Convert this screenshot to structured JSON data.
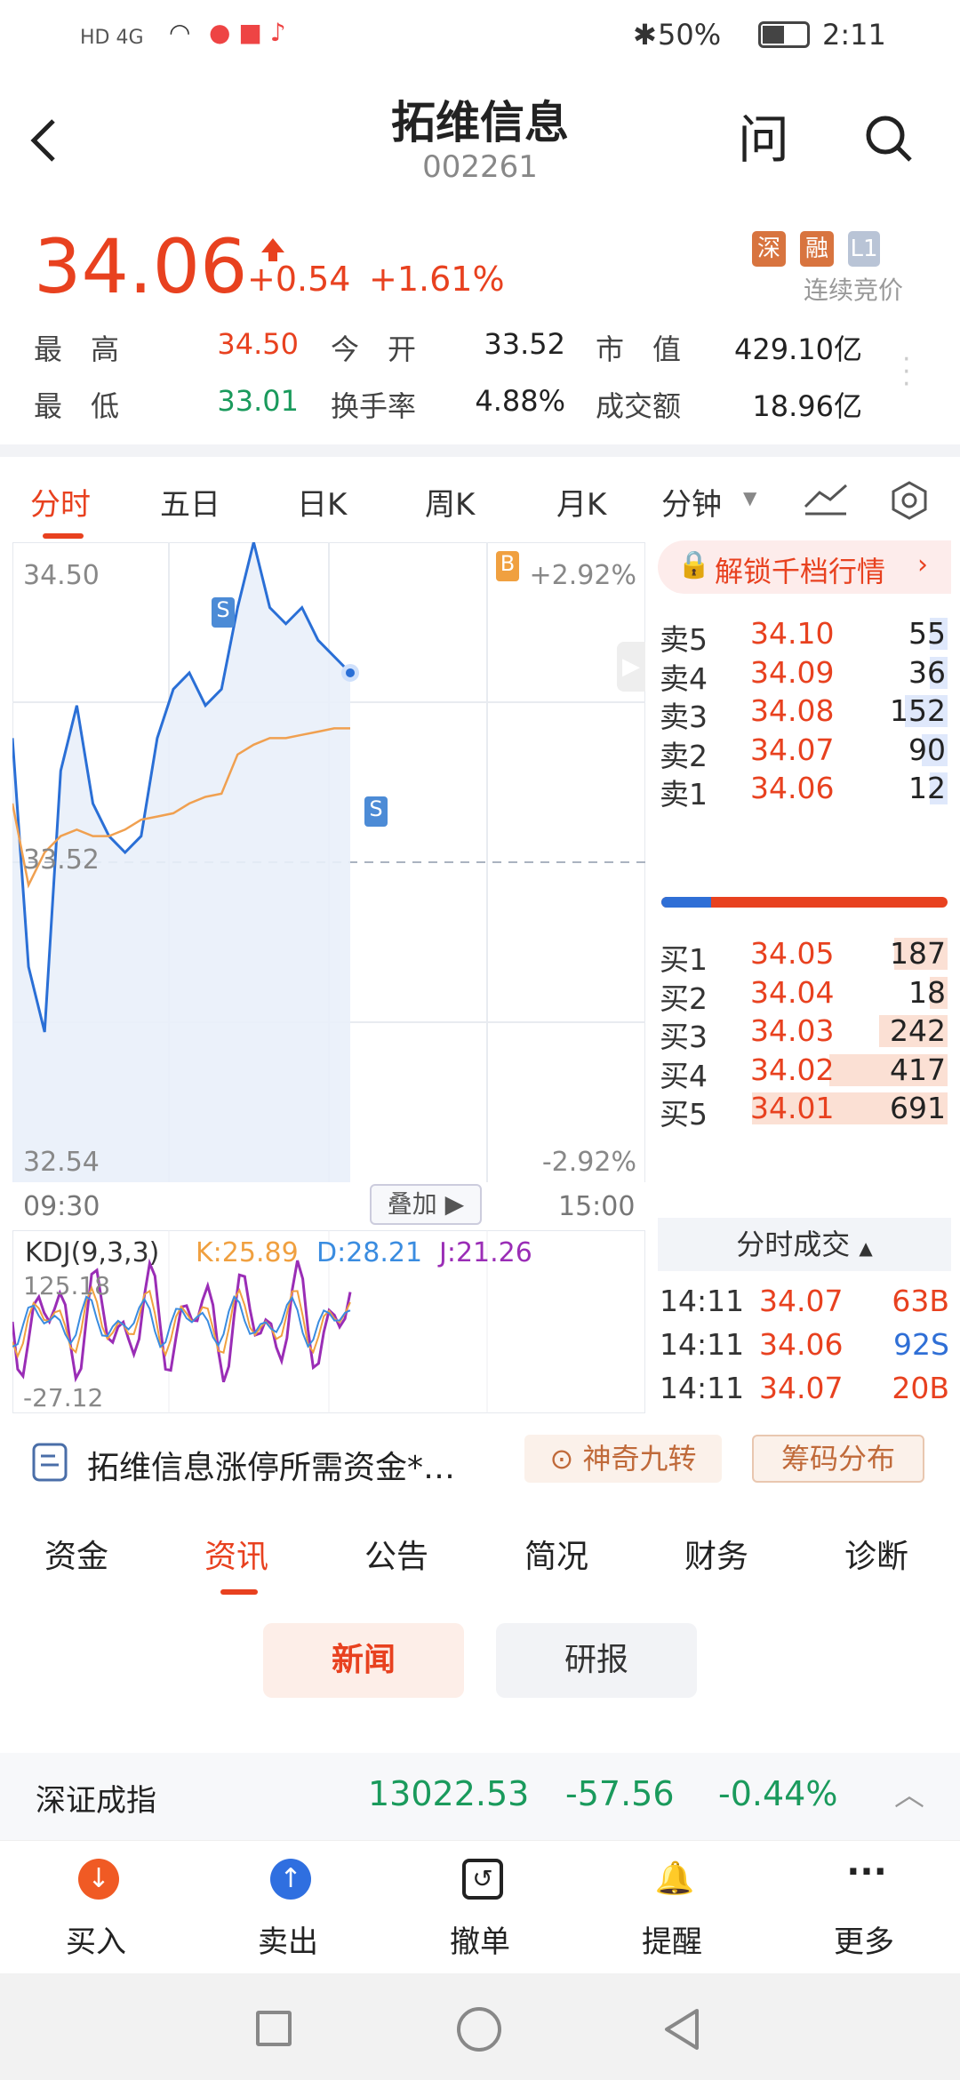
{
  "status_bar": {
    "network": "HD 4G",
    "battery": "50%",
    "time": "2:11"
  },
  "header": {
    "name": "拓维信息",
    "code": "002261",
    "ask_icon": "问"
  },
  "quote": {
    "price": "34.06",
    "change": "+0.54",
    "change_pct": "+1.61%",
    "tags": [
      "深",
      "融",
      "L1"
    ],
    "trading_status": "连续竞价",
    "rows": [
      [
        {
          "label": "最　高",
          "value": "34.50",
          "color": "red"
        },
        {
          "label": "今　开",
          "value": "33.52",
          "color": "default"
        },
        {
          "label": "市　值",
          "value": "429.10亿",
          "color": "default"
        }
      ],
      [
        {
          "label": "最　低",
          "value": "33.01",
          "color": "green"
        },
        {
          "label": "换手率",
          "value": "4.88%",
          "color": "default"
        },
        {
          "label": "成交额",
          "value": "18.96亿",
          "color": "default"
        }
      ]
    ]
  },
  "chart_tabs": [
    "分时",
    "五日",
    "日K",
    "周K",
    "月K",
    "分钟"
  ],
  "chart": {
    "price_high": "34.50",
    "price_low": "32.54",
    "price_mid": "33.52",
    "pct_high": "+2.92%",
    "pct_low": "-2.92%",
    "time_start": "09:30",
    "time_end": "15:00",
    "overlay_btn": "叠加",
    "kdj": {
      "name": "KDJ(9,3,3)",
      "k": "K:25.89",
      "d": "D:28.21",
      "j": "J:21.26",
      "top": "125.18",
      "bottom": "-27.12"
    },
    "markers": [
      "S",
      "S",
      "B"
    ]
  },
  "chart_data": {
    "type": "line",
    "series": [
      {
        "values": [
          33.9,
          33.2,
          33.0,
          33.8,
          34.0,
          33.7,
          33.6,
          33.55,
          33.6,
          33.9,
          34.05,
          34.1,
          34.0,
          34.05,
          34.3,
          34.5,
          34.3,
          34.25,
          34.3,
          34.2,
          34.15,
          34.1
        ]
      },
      {
        "values": [
          33.7,
          33.45,
          33.55,
          33.6,
          33.62,
          33.6,
          33.6,
          33.62,
          33.65,
          33.66,
          33.67,
          33.7,
          33.72,
          33.73,
          33.85,
          33.88,
          33.9,
          33.9,
          33.91,
          33.92,
          33.93,
          33.93
        ]
      }
    ],
    "ylim": [
      32.54,
      34.5
    ]
  },
  "orderbook": {
    "unlock": "解锁千档行情",
    "asks": [
      {
        "label": "卖5",
        "price": "34.10",
        "vol": "55"
      },
      {
        "label": "卖4",
        "price": "34.09",
        "vol": "36"
      },
      {
        "label": "卖3",
        "price": "34.08",
        "vol": "152"
      },
      {
        "label": "卖2",
        "price": "34.07",
        "vol": "90"
      },
      {
        "label": "卖1",
        "price": "34.06",
        "vol": "12"
      }
    ],
    "bids": [
      {
        "label": "买1",
        "price": "34.05",
        "vol": "187"
      },
      {
        "label": "买2",
        "price": "34.04",
        "vol": "18"
      },
      {
        "label": "买3",
        "price": "34.03",
        "vol": "242"
      },
      {
        "label": "买4",
        "price": "34.02",
        "vol": "417"
      },
      {
        "label": "买5",
        "price": "34.01",
        "vol": "691"
      }
    ],
    "trades_title": "分时成交",
    "trades": [
      {
        "time": "14:11",
        "price": "34.07",
        "vol": "63B"
      },
      {
        "time": "14:11",
        "price": "34.06",
        "vol": "92S"
      },
      {
        "time": "14:11",
        "price": "34.07",
        "vol": "20B"
      }
    ]
  },
  "news_strip": {
    "text": "拓维信息涨停所需资金*…",
    "btn1": "神奇九转",
    "btn2": "筹码分布"
  },
  "info_tabs": [
    "资金",
    "资讯",
    "公告",
    "简况",
    "财务",
    "诊断"
  ],
  "sub_tabs": [
    "新闻",
    "研报"
  ],
  "index_bar": {
    "name": "深证成指",
    "value": "13022.53",
    "change": "-57.56",
    "pct": "-0.44%"
  },
  "bottom_bar": [
    "买入",
    "卖出",
    "撤单",
    "提醒",
    "更多"
  ]
}
